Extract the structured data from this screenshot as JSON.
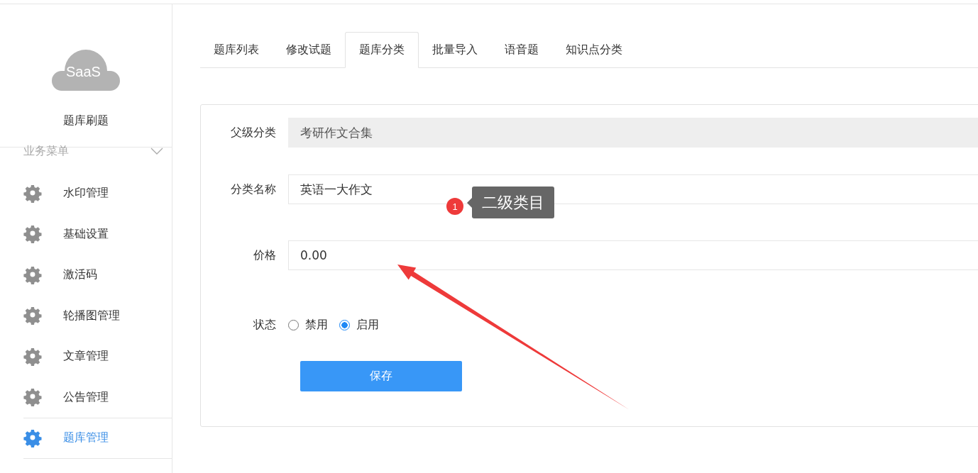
{
  "sidebar": {
    "logo_text": "SaaS",
    "app_name": "题库刷题",
    "menu_group": {
      "label": "业务菜单",
      "expanded": true
    },
    "items": [
      {
        "label": "水印管理",
        "selected": false
      },
      {
        "label": "基础设置",
        "selected": false
      },
      {
        "label": "激活码",
        "selected": false
      },
      {
        "label": "轮播图管理",
        "selected": false
      },
      {
        "label": "文章管理",
        "selected": false
      },
      {
        "label": "公告管理",
        "selected": false
      },
      {
        "label": "题库管理",
        "selected": true
      }
    ]
  },
  "tabs": [
    {
      "label": "题库列表",
      "selected": false
    },
    {
      "label": "修改试题",
      "selected": false
    },
    {
      "label": "题库分类",
      "selected": true
    },
    {
      "label": "批量导入",
      "selected": false
    },
    {
      "label": "语音题",
      "selected": false
    },
    {
      "label": "知识点分类",
      "selected": false
    }
  ],
  "form": {
    "fields": [
      {
        "kind": "readonly",
        "label": "父级分类",
        "value": "考研作文合集"
      },
      {
        "kind": "text",
        "label": "分类名称",
        "value": "英语一大作文"
      },
      {
        "kind": "text",
        "label": "价格",
        "value": "0.00"
      },
      {
        "kind": "radio",
        "label": "状态",
        "options": [
          {
            "label": "禁用",
            "selected": false
          },
          {
            "label": "启用",
            "selected": true
          }
        ]
      }
    ],
    "submit": "保存"
  },
  "annotation": {
    "badge": "1",
    "callout": "二级类目"
  }
}
